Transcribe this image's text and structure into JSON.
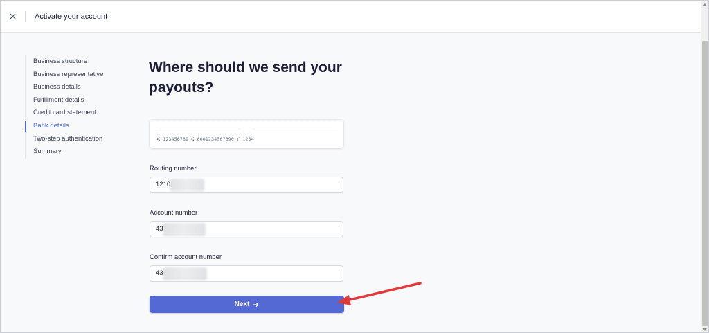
{
  "topbar": {
    "close_icon": "close-icon",
    "title": "Activate your account"
  },
  "sidebar": {
    "items": [
      {
        "label": "Business structure",
        "active": false
      },
      {
        "label": "Business representative",
        "active": false
      },
      {
        "label": "Business details",
        "active": false
      },
      {
        "label": "Fulfillment details",
        "active": false
      },
      {
        "label": "Credit card statement",
        "active": false
      },
      {
        "label": "Bank details",
        "active": true
      },
      {
        "label": "Two-step authentication",
        "active": false
      },
      {
        "label": "Summary",
        "active": false
      }
    ]
  },
  "main": {
    "heading": "Where should we send your payouts?",
    "check_example": "⑆ 123456789 ⑆ 0001234567890 ⑈ 1234",
    "routing": {
      "label": "Routing number",
      "value": "1210"
    },
    "account": {
      "label": "Account number",
      "value": "43"
    },
    "confirm": {
      "label": "Confirm account number",
      "value": "43"
    },
    "next_button": {
      "label": "Next",
      "icon": "arrow-right-icon"
    }
  },
  "colors": {
    "accent": "#5469d4",
    "annotation_arrow": "#e03a3a",
    "background": "#f7f9fb"
  }
}
